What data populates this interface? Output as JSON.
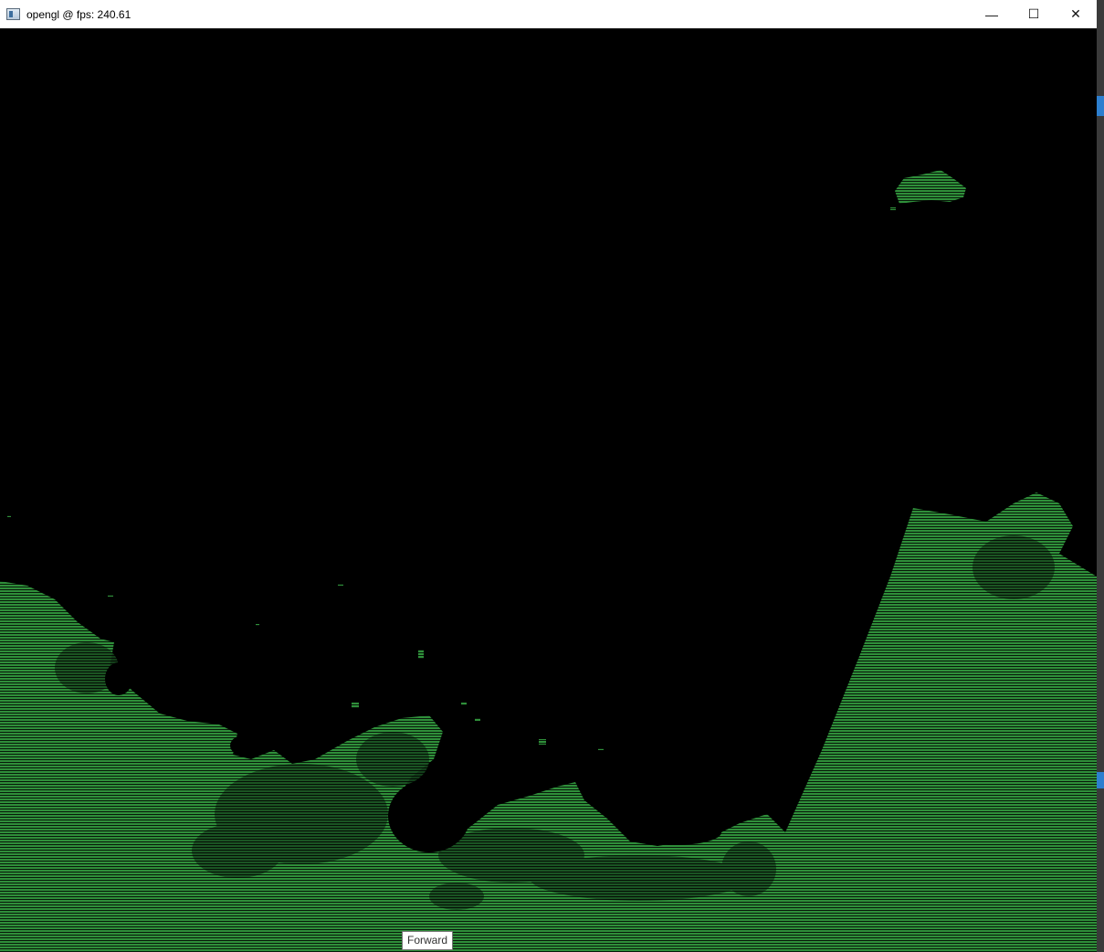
{
  "window": {
    "title": "opengl @ fps: 240.61",
    "app_icon": "window-app-icon"
  },
  "caption_buttons": {
    "minimize_glyph": "—",
    "maximize_glyph": "☐",
    "close_glyph": "✕"
  },
  "scene": {
    "description_colors": {
      "land": "#2f8f3a",
      "land_dark": "#1a4f22",
      "background": "#000000"
    }
  },
  "tooltip": {
    "text": "Forward"
  }
}
